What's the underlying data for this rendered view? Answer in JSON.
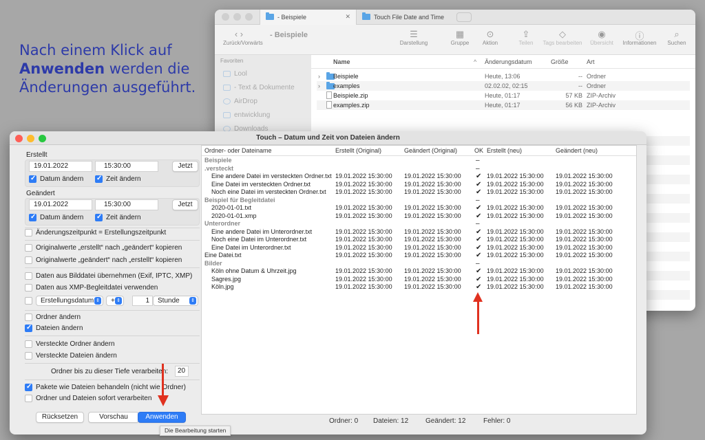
{
  "headline": {
    "part1": "Nach einem Klick auf ",
    "bold": "Anwenden",
    "part2": " werden die Änderungen ausgeführt."
  },
  "finder": {
    "tab1": "- Beispiele",
    "tab2": "Touch File Date and Time",
    "nav_label": "Zurück/Vorwärts",
    "title": "- Beispiele",
    "toolbar": [
      "Darstellung",
      "Gruppe",
      "Aktion",
      "Teilen",
      "Tags bearbeiten",
      "Übersicht",
      "Informationen",
      "Suchen"
    ],
    "sidebar_header": "Favoriten",
    "sidebar": [
      "Lool",
      "- Text & Dokumente",
      "AirDrop",
      "entwicklung",
      "Downloads"
    ],
    "columns": {
      "name": "Name",
      "date": "Änderungsdatum",
      "size": "Größe",
      "kind": "Art"
    },
    "rows": [
      {
        "name": "Beispiele",
        "date": "Heute, 13:06",
        "size": "--",
        "kind": "Ordner",
        "type": "folder"
      },
      {
        "name": "examples",
        "date": "02.02.02, 02:15",
        "size": "--",
        "kind": "Ordner",
        "type": "folder"
      },
      {
        "name": "Beispiele.zip",
        "date": "Heute, 01:17",
        "size": "57 KB",
        "kind": "ZIP-Archiv",
        "type": "file"
      },
      {
        "name": "examples.zip",
        "date": "Heute, 01:17",
        "size": "56 KB",
        "kind": "ZIP-Archiv",
        "type": "file"
      }
    ]
  },
  "touch": {
    "title": "Touch – Datum und Zeit von Dateien ändern",
    "created_label": "Erstellt",
    "created_date": "19.01.2022",
    "created_time": "15:30:00",
    "now_label": "Jetzt",
    "date_change": "Datum ändern",
    "time_change": "Zeit ändern",
    "modified_label": "Geändert",
    "modified_date": "19.01.2022",
    "modified_time": "15:30:00",
    "opt_mod_eq_created": "Änderungszeitpunkt = Erstellungszeitpunkt",
    "opt_copy_created": "Originalwerte „erstellt“ nach „geändert“ kopieren",
    "opt_copy_modified": "Originalwerte „geändert“ nach „erstellt“ kopieren",
    "opt_exif": "Daten aus Bilddatei übernehmen (Exif, IPTC, XMP)",
    "opt_xmp": "Daten aus XMP-Begleitdatei verwenden",
    "offset_field": "Erstellungsdatum",
    "offset_sign": "+",
    "offset_value": "1",
    "offset_unit": "Stunde",
    "opt_folders": "Ordner ändern",
    "opt_files": "Dateien ändern",
    "opt_hidden_folders": "Versteckte Ordner ändern",
    "opt_hidden_files": "Versteckte Dateien ändern",
    "depth_label": "Ordner bis zu dieser Tiefe verarbeiten:",
    "depth_value": "20",
    "opt_packages": "Pakete wie Dateien behandeln (nicht wie Ordner)",
    "opt_immediate": "Ordner und Dateien sofort verarbeiten",
    "reset_button": "Rücksetzen",
    "preview_button": "Vorschau",
    "apply_button": "Anwenden",
    "tooltip": "Die Bearbeitung starten",
    "columns": [
      "Ordner- oder Dateiname",
      "Erstellt (Original)",
      "Geändert (Original)",
      "OK",
      "Erstellt (neu)",
      "Geändert (neu)"
    ],
    "rows": [
      {
        "name": "Beispiele",
        "group": true,
        "indent": 0,
        "ok": "–"
      },
      {
        "name": ".versteckt",
        "group": true,
        "indent": 0,
        "ok": "–"
      },
      {
        "name": "Eine andere Datei im versteckten Ordner.txt",
        "indent": 1,
        "c": "19.01.2022  15:30:00",
        "m": "19.01.2022  15:30:00",
        "ok": "✔",
        "cn": "19.01.2022  15:30:00",
        "mn": "19.01.2022  15:30:00"
      },
      {
        "name": "Eine Datei im versteckten Ordner.txt",
        "indent": 1,
        "c": "19.01.2022  15:30:00",
        "m": "19.01.2022  15:30:00",
        "ok": "✔",
        "cn": "19.01.2022  15:30:00",
        "mn": "19.01.2022  15:30:00"
      },
      {
        "name": "Noch eine Datei im versteckten Ordner.txt",
        "indent": 1,
        "c": "19.01.2022  15:30:00",
        "m": "19.01.2022  15:30:00",
        "ok": "✔",
        "cn": "19.01.2022  15:30:00",
        "mn": "19.01.2022  15:30:00"
      },
      {
        "name": "Beispiel für Begleitdatei",
        "group": true,
        "indent": 0,
        "ok": "–"
      },
      {
        "name": "2020-01-01.txt",
        "indent": 1,
        "c": "19.01.2022  15:30:00",
        "m": "19.01.2022  15:30:00",
        "ok": "✔",
        "cn": "19.01.2022  15:30:00",
        "mn": "19.01.2022  15:30:00"
      },
      {
        "name": "2020-01-01.xmp",
        "indent": 1,
        "c": "19.01.2022  15:30:00",
        "m": "19.01.2022  15:30:00",
        "ok": "✔",
        "cn": "19.01.2022  15:30:00",
        "mn": "19.01.2022  15:30:00"
      },
      {
        "name": "Unterordner",
        "group": true,
        "indent": 0,
        "ok": "–"
      },
      {
        "name": "Eine andere Datei im Unterordner.txt",
        "indent": 1,
        "c": "19.01.2022  15:30:00",
        "m": "19.01.2022  15:30:00",
        "ok": "✔",
        "cn": "19.01.2022  15:30:00",
        "mn": "19.01.2022  15:30:00"
      },
      {
        "name": "Noch eine Datei im Unterordner.txt",
        "indent": 1,
        "c": "19.01.2022  15:30:00",
        "m": "19.01.2022  15:30:00",
        "ok": "✔",
        "cn": "19.01.2022  15:30:00",
        "mn": "19.01.2022  15:30:00"
      },
      {
        "name": "Eine Datei im Unterordner.txt",
        "indent": 1,
        "c": "19.01.2022  15:30:00",
        "m": "19.01.2022  15:30:00",
        "ok": "✔",
        "cn": "19.01.2022  15:30:00",
        "mn": "19.01.2022  15:30:00"
      },
      {
        "name": "Eine Datei.txt",
        "indent": 0,
        "c": "19.01.2022  15:30:00",
        "m": "19.01.2022  15:30:00",
        "ok": "✔",
        "cn": "19.01.2022  15:30:00",
        "mn": "19.01.2022  15:30:00"
      },
      {
        "name": "Bilder",
        "group": true,
        "indent": 0,
        "ok": "–"
      },
      {
        "name": "Köln ohne Datum & Uhrzeit.jpg",
        "indent": 1,
        "c": "19.01.2022  15:30:00",
        "m": "19.01.2022  15:30:00",
        "ok": "✔",
        "cn": "19.01.2022  15:30:00",
        "mn": "19.01.2022  15:30:00"
      },
      {
        "name": "Sagres.jpg",
        "indent": 1,
        "c": "19.01.2022  15:30:00",
        "m": "19.01.2022  15:30:00",
        "ok": "✔",
        "cn": "19.01.2022  15:30:00",
        "mn": "19.01.2022  15:30:00"
      },
      {
        "name": "Köln.jpg",
        "indent": 1,
        "c": "19.01.2022  15:30:00",
        "m": "19.01.2022  15:30:00",
        "ok": "✔",
        "cn": "19.01.2022  15:30:00",
        "mn": "19.01.2022  15:30:00"
      }
    ],
    "status": {
      "folders": "Ordner: 0",
      "files": "Dateien: 12",
      "changed": "Geändert: 12",
      "errors": "Fehler: 0"
    },
    "checked": {
      "created_date": true,
      "created_time": true,
      "modified_date": true,
      "modified_time": true,
      "files": true,
      "packages": true
    }
  },
  "colors": {
    "accent": "#2e7cf6",
    "headline": "#2d3aa8",
    "arrow": "#e0311f"
  }
}
